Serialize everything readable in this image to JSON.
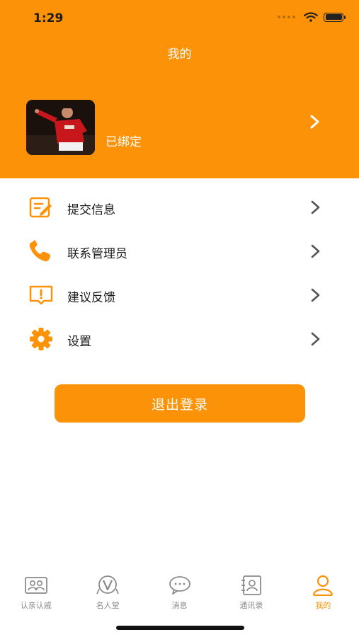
{
  "status_bar": {
    "time": "1:29"
  },
  "header": {
    "title": "我的",
    "bind_status": "已绑定"
  },
  "menu": {
    "items": [
      {
        "label": "提交信息",
        "icon": "edit-document-icon"
      },
      {
        "label": "联系管理员",
        "icon": "phone-icon"
      },
      {
        "label": "建议反馈",
        "icon": "feedback-icon"
      },
      {
        "label": "设置",
        "icon": "gear-icon"
      }
    ]
  },
  "logout": {
    "label": "退出登录"
  },
  "tabbar": {
    "tabs": [
      {
        "label": "认亲认戚",
        "icon": "people-icon"
      },
      {
        "label": "名人堂",
        "icon": "badge-icon"
      },
      {
        "label": "消息",
        "icon": "chat-icon"
      },
      {
        "label": "通讯录",
        "icon": "contacts-icon"
      },
      {
        "label": "我的",
        "icon": "profile-icon"
      }
    ],
    "active_index": 4
  },
  "colors": {
    "accent": "#fb9207",
    "text": "#1a1a1a",
    "tab_inactive": "#8a8a8a"
  }
}
